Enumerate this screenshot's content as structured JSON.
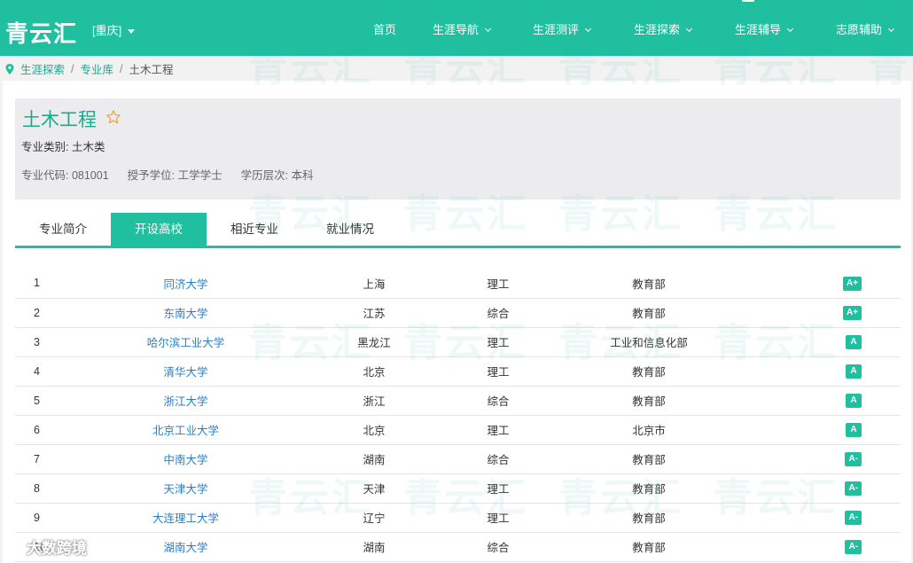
{
  "app": {
    "logo": "青云汇",
    "city": "[重庆]",
    "watermark": "青云汇"
  },
  "nav": [
    {
      "label": "首页",
      "has_menu": false
    },
    {
      "label": "生涯导航",
      "has_menu": true
    },
    {
      "label": "生涯测评",
      "has_menu": true
    },
    {
      "label": "生涯探索",
      "has_menu": true
    },
    {
      "label": "生涯辅导",
      "has_menu": true
    },
    {
      "label": "志愿辅助",
      "has_menu": true
    }
  ],
  "breadcrumb": {
    "items": [
      "生涯探索",
      "专业库"
    ],
    "current": "土木工程",
    "separator": "/"
  },
  "major": {
    "title": "土木工程",
    "category": "专业类别: 土木类",
    "code": "专业代码: 081001",
    "degree": "授予学位: 工学学士",
    "level": "学历层次: 本科"
  },
  "tabs": [
    {
      "label": "专业简介",
      "active": false
    },
    {
      "label": "开设高校",
      "active": true
    },
    {
      "label": "相近专业",
      "active": false
    },
    {
      "label": "就业情况",
      "active": false
    }
  ],
  "schools": [
    {
      "rank": "1",
      "name": "同济大学",
      "province": "上海",
      "type": "理工",
      "dept": "教育部",
      "grade": "A+"
    },
    {
      "rank": "2",
      "name": "东南大学",
      "province": "江苏",
      "type": "综合",
      "dept": "教育部",
      "grade": "A+"
    },
    {
      "rank": "3",
      "name": "哈尔滨工业大学",
      "province": "黑龙江",
      "type": "理工",
      "dept": "工业和信息化部",
      "grade": "A"
    },
    {
      "rank": "4",
      "name": "清华大学",
      "province": "北京",
      "type": "理工",
      "dept": "教育部",
      "grade": "A"
    },
    {
      "rank": "5",
      "name": "浙江大学",
      "province": "浙江",
      "type": "综合",
      "dept": "教育部",
      "grade": "A"
    },
    {
      "rank": "6",
      "name": "北京工业大学",
      "province": "北京",
      "type": "理工",
      "dept": "北京市",
      "grade": "A"
    },
    {
      "rank": "7",
      "name": "中南大学",
      "province": "湖南",
      "type": "综合",
      "dept": "教育部",
      "grade": "A-"
    },
    {
      "rank": "8",
      "name": "天津大学",
      "province": "天津",
      "type": "理工",
      "dept": "教育部",
      "grade": "A-"
    },
    {
      "rank": "9",
      "name": "大连理工大学",
      "province": "辽宁",
      "type": "理工",
      "dept": "教育部",
      "grade": "A-"
    },
    {
      "rank": "10",
      "name": "湖南大学",
      "province": "湖南",
      "type": "综合",
      "dept": "教育部",
      "grade": "A-"
    }
  ],
  "corner_watermark": "大数跨境",
  "colors": {
    "brand": "#1fbf9f",
    "link": "#2a7fc6",
    "panel": "#ececee"
  }
}
